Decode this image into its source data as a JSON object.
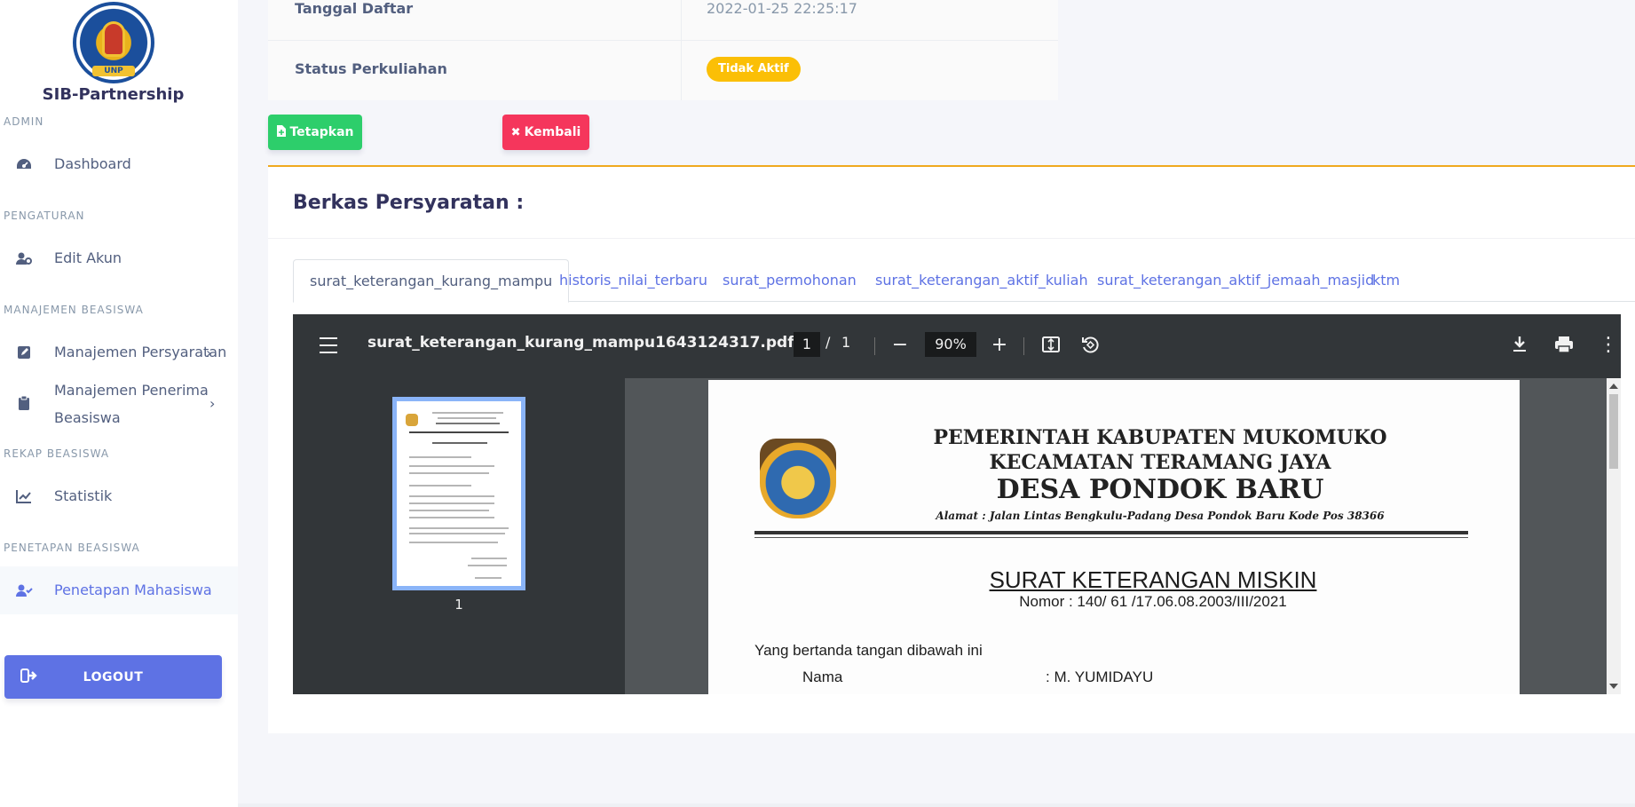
{
  "sidebar": {
    "brand": "SIB-Partnership",
    "logo_text": "UNIVERSITAS NEGERI PADANG · UNP",
    "logo_ribbon": "UNP",
    "sections": [
      {
        "heading": "ADMIN",
        "items": [
          {
            "label": "Dashboard",
            "icon": "dashboard-icon"
          }
        ]
      },
      {
        "heading": "PENGATURAN",
        "items": [
          {
            "label": "Edit Akun",
            "icon": "users-cog-icon"
          }
        ]
      },
      {
        "heading": "MANAJEMEN BEASISWA",
        "items": [
          {
            "label": "Manajemen Persyaratan",
            "icon": "edit-icon"
          },
          {
            "label_line1": "Manajemen Penerima",
            "label_line2": "Beasiswa",
            "icon": "clipboard-icon"
          }
        ]
      },
      {
        "heading": "REKAP BEASISWA",
        "items": [
          {
            "label": "Statistik",
            "icon": "chart-line-icon"
          }
        ]
      },
      {
        "heading": "PENETAPAN BEASISWA",
        "items": [
          {
            "label": "Penetapan Mahasiswa",
            "icon": "user-check-icon",
            "active": true
          }
        ]
      }
    ],
    "logout": "LOGOUT"
  },
  "details": {
    "rows": [
      {
        "key": "Tanggal Daftar",
        "value": "2022-01-25 22:25:17"
      },
      {
        "key": "Status Perkuliahan",
        "value": "Tidak Aktif"
      }
    ],
    "badge_color": "#fbbf06"
  },
  "actions": {
    "tetapkan": "Tetapkan",
    "kembali": "Kembali"
  },
  "berkas": {
    "title": "Berkas Persyaratan :",
    "tabs": [
      "surat_keterangan_kurang_mampu",
      "historis_nilai_terbaru",
      "surat_permohonan",
      "surat_keterangan_aktif_kuliah",
      "surat_keterangan_aktif_jemaah_masjid",
      "ktm"
    ],
    "active_tab": 0
  },
  "pdf": {
    "filename": "surat_keterangan_kurang_mampu1643124317.pdf",
    "page_current": "1",
    "page_sep": "/",
    "page_total": "1",
    "zoom": "90%",
    "thumb_label": "1",
    "document": {
      "line1": "PEMERINTAH KABUPATEN MUKOMUKO",
      "line2": "KECAMATAN TERAMANG JAYA",
      "line3": "DESA PONDOK BARU",
      "address": "Alamat : Jalan Lintas  Bengkulu-Padang Desa Pondok Baru Kode Pos 38366",
      "title": "SURAT KETERANGAN MISKIN",
      "nomor": "Nomor : 140/  61   /17.06.08.2003/III/2021",
      "intro": "Yang bertanda tangan dibawah ini",
      "field_label": "Nama",
      "field_value": ": M. YUMIDAYU"
    }
  },
  "colors": {
    "primary": "#5e72e4",
    "success": "#2dce6b",
    "danger": "#f5365c",
    "warning": "#fbbf06",
    "accent_border": "#f0a91e"
  }
}
